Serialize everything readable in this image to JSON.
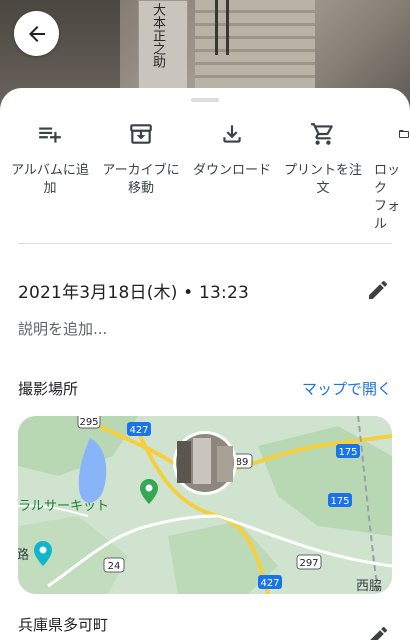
{
  "photo": {
    "stone_text": "大本正之助"
  },
  "header": {
    "back_icon": "arrow-left-icon"
  },
  "actions": [
    {
      "icon": "playlist-add-icon",
      "label": "アルバムに追\n加"
    },
    {
      "icon": "archive-icon",
      "label": "アーカイブに\n移動"
    },
    {
      "icon": "download-icon",
      "label": "ダウンロード"
    },
    {
      "icon": "cart-icon",
      "label": "プリントを注\n文"
    },
    {
      "icon": "lock-folder-icon",
      "label": "ロック\nフォル"
    }
  ],
  "details": {
    "datetime": "2021年3月18日(木) • 13:23",
    "description_placeholder": "説明を追加...",
    "location_title": "撮影場所",
    "open_map_link": "マップで開く",
    "place_name": "兵庫県多可町"
  },
  "map": {
    "roads": [
      "295",
      "427",
      "89",
      "175",
      "175",
      "297",
      "24",
      "427"
    ],
    "labels": [
      "ラルサーキット",
      "路",
      "西脇"
    ]
  },
  "colors": {
    "accent": "#1a73e8",
    "map_land": "#cfe3cf",
    "road_yellow": "#f6cf3f",
    "pin_green": "#34a853"
  }
}
